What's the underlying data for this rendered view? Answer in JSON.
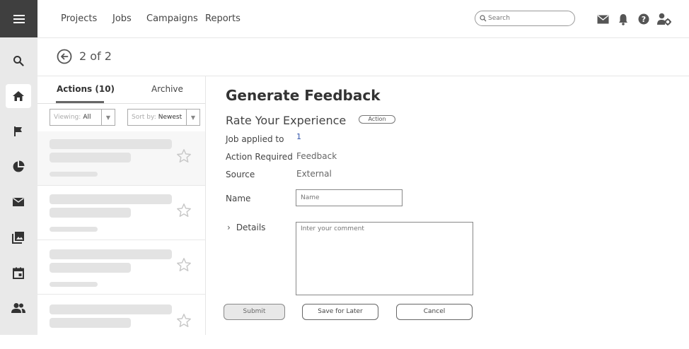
{
  "nav": {
    "items": [
      "Projects",
      "Jobs",
      "Campaigns",
      "Reports"
    ]
  },
  "search": {
    "placeholder": "Search"
  },
  "pager": {
    "text": "2 of 2"
  },
  "list": {
    "tabs": [
      "Actions (10)",
      "Archive"
    ],
    "viewing": {
      "label": "Viewing:",
      "value": "All"
    },
    "sort": {
      "label": "Sort by:",
      "value": "Newest"
    }
  },
  "detail": {
    "title": "Generate Feedback",
    "subtitle": "Rate Your Experience",
    "badge": "Action",
    "fields": [
      {
        "label": "Job applied to",
        "value": "1"
      },
      {
        "label": "Action Required",
        "value": "Feedback"
      },
      {
        "label": "Source",
        "value": "External"
      }
    ],
    "name_label": "Name",
    "name_placeholder": "Name",
    "details_label": "Details",
    "comment_placeholder": "Inter your comment"
  },
  "buttons": {
    "submit": "Submit",
    "save_later": "Save for Later",
    "cancel": "Cancel"
  },
  "colors": {
    "sidebar_bg": "#e9e9e9",
    "menu_bg": "#3f3f3f",
    "accent_link": "#3355aa"
  },
  "icons": {
    "sidebar": [
      "menu-icon",
      "search-icon",
      "home-icon",
      "flag-icon",
      "pie-chart-icon",
      "mail-icon",
      "image-icon",
      "calendar-icon",
      "people-icon"
    ],
    "topbar": [
      "mail-icon",
      "bell-icon",
      "help-icon",
      "user-settings-icon"
    ]
  }
}
